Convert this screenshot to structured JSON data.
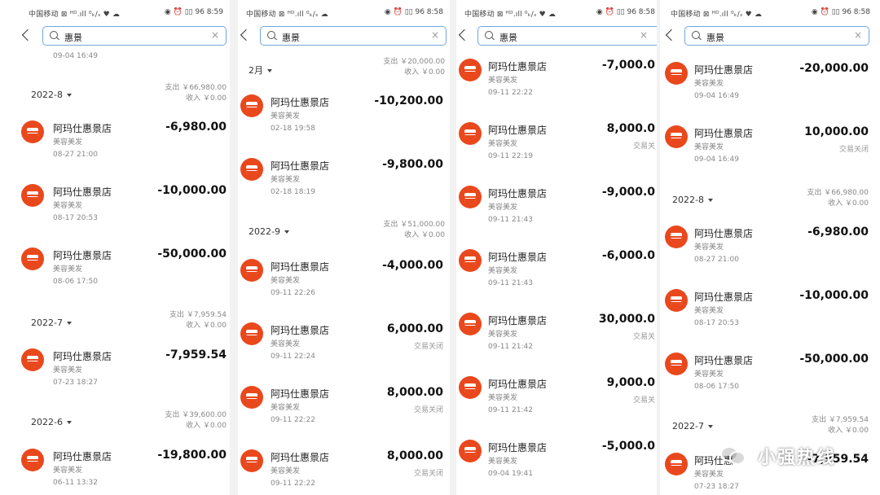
{
  "panels": [
    {
      "status": {
        "carrier": "中国移动 ⊠ ᴴᴰ.ıll ⁰ₖ/ₛ ♥ ☁",
        "right": "◉ ⏰ ▯▯ 96 8:59"
      },
      "search": {
        "value": "惠景",
        "clear": "×"
      },
      "top_time": "09-04 16:49",
      "items": [
        {
          "merchant": "阿玛仕惠景店",
          "cat": "美容美发",
          "time": "08-27 21:00",
          "amount": "-6,980.00",
          "note": ""
        },
        {
          "merchant": "阿玛仕惠景店",
          "cat": "美容美发",
          "time": "08-17 20:53",
          "amount": "-10,000.00",
          "note": ""
        },
        {
          "merchant": "阿玛仕惠景店",
          "cat": "美容美发",
          "time": "08-06 17:50",
          "amount": "-50,000.00",
          "note": ""
        },
        {
          "merchant": "阿玛仕惠景店",
          "cat": "美容美发",
          "time": "07-23 18:27",
          "amount": "-7,959.54",
          "note": ""
        },
        {
          "merchant": "阿玛仕惠景店",
          "cat": "美容美发",
          "time": "06-11 13:32",
          "amount": "-19,800.00",
          "note": ""
        }
      ],
      "months": [
        {
          "label": "2022-8",
          "out": "支出 ￥66,980.00",
          "in": "收入 ￥0.00"
        },
        {
          "label": "2022-7",
          "out": "支出 ￥7,959.54",
          "in": "收入 ￥0.00"
        },
        {
          "label": "2022-6",
          "out": "支出 ￥39,600.00",
          "in": "收入 ￥0.00"
        }
      ]
    },
    {
      "status": {
        "carrier": "中国移动 ⊠ ᴴᴰ.ıll ⁰ₖ/ₛ ☁",
        "right": "◉ ⏰ ▯▯ 96 8:58"
      },
      "search": {
        "value": "惠景",
        "clear": "×"
      },
      "items": [
        {
          "merchant": "阿玛仕惠景店",
          "cat": "美容美发",
          "time": "02-18 19:58",
          "amount": "-10,200.00",
          "note": ""
        },
        {
          "merchant": "阿玛仕惠景店",
          "cat": "美容美发",
          "time": "02-18 18:19",
          "amount": "-9,800.00",
          "note": ""
        },
        {
          "merchant": "阿玛仕惠景店",
          "cat": "美容美发",
          "time": "09-11 22:26",
          "amount": "-4,000.00",
          "note": ""
        },
        {
          "merchant": "阿玛仕惠景店",
          "cat": "美容美发",
          "time": "09-11 22:24",
          "amount": "6,000.00",
          "note": "交易关闭"
        },
        {
          "merchant": "阿玛仕惠景店",
          "cat": "美容美发",
          "time": "09-11 22:22",
          "amount": "8,000.00",
          "note": "交易关闭"
        },
        {
          "merchant": "阿玛仕惠景店",
          "cat": "美容美发",
          "time": "09-11 22:22",
          "amount": "8,000.00",
          "note": "交易关闭"
        }
      ],
      "months": [
        {
          "label": "2月",
          "out": "支出 ￥20,000.00",
          "in": "收入 ￥0.00"
        },
        {
          "label": "2022-9",
          "out": "支出 ￥51,000.00",
          "in": "收入 ￥0.00"
        }
      ]
    },
    {
      "status": {
        "carrier": "中国移动 ⊠ ᴴᴰ.ıll ⁰ₖ/ₛ ♥ ☁",
        "right": "◉ ⏰ ▯▯ 96 8:58"
      },
      "search": {
        "value": "惠景",
        "clear": "×"
      },
      "items": [
        {
          "merchant": "阿玛仕惠景店",
          "cat": "美容美发",
          "time": "09-11 22:22",
          "amount": "-7,000.0",
          "note": ""
        },
        {
          "merchant": "阿玛仕惠景店",
          "cat": "美容美发",
          "time": "09-11 22:19",
          "amount": "8,000.0",
          "note": "交易关"
        },
        {
          "merchant": "阿玛仕惠景店",
          "cat": "美容美发",
          "time": "09-11 21:43",
          "amount": "-9,000.0",
          "note": ""
        },
        {
          "merchant": "阿玛仕惠景店",
          "cat": "美容美发",
          "time": "09-11 21:43",
          "amount": "-6,000.0",
          "note": ""
        },
        {
          "merchant": "阿玛仕惠景店",
          "cat": "美容美发",
          "time": "09-11 21:42",
          "amount": "30,000.0",
          "note": "交易关"
        },
        {
          "merchant": "阿玛仕惠景店",
          "cat": "美容美发",
          "time": "09-11 21:42",
          "amount": "9,000.0",
          "note": "交易关"
        },
        {
          "merchant": "阿玛仕惠景店",
          "cat": "美容美发",
          "time": "09-04 19:41",
          "amount": "-5,000.0",
          "note": ""
        }
      ]
    },
    {
      "status": {
        "carrier": "中国移动 ⊠ ᴴᴰ.ıll ⁰ₖ/ₛ ♥ ☁",
        "right": "◉ ⏰ ▯▯ 96 8:58"
      },
      "search": {
        "value": "惠景",
        "clear": "×"
      },
      "items": [
        {
          "merchant": "阿玛仕惠景店",
          "cat": "美容美发",
          "time": "09-04 16:49",
          "amount": "-20,000.00",
          "note": ""
        },
        {
          "merchant": "阿玛仕惠景店",
          "cat": "美容美发",
          "time": "09-04 16:49",
          "amount": "10,000.00",
          "note": "交易关闭"
        },
        {
          "merchant": "阿玛仕惠景店",
          "cat": "美容美发",
          "time": "08-27 21:00",
          "amount": "-6,980.00",
          "note": ""
        },
        {
          "merchant": "阿玛仕惠景店",
          "cat": "美容美发",
          "time": "08-17 20:53",
          "amount": "-10,000.00",
          "note": ""
        },
        {
          "merchant": "阿玛仕惠景店",
          "cat": "美容美发",
          "time": "08-06 17:50",
          "amount": "-50,000.00",
          "note": ""
        },
        {
          "merchant": "阿玛仕惠",
          "cat": "美容美发",
          "time": "07-23 18:27",
          "amount": "-7,959.54",
          "note": ""
        }
      ],
      "months": [
        {
          "label": "2022-8",
          "out": "支出 ￥66,980.00",
          "in": "收入 ￥0.00"
        },
        {
          "label": "2022-7",
          "out": "支出 ￥7,959.54",
          "in": "收入 ￥0.00"
        }
      ]
    }
  ],
  "watermark": {
    "text": "小强热线"
  }
}
